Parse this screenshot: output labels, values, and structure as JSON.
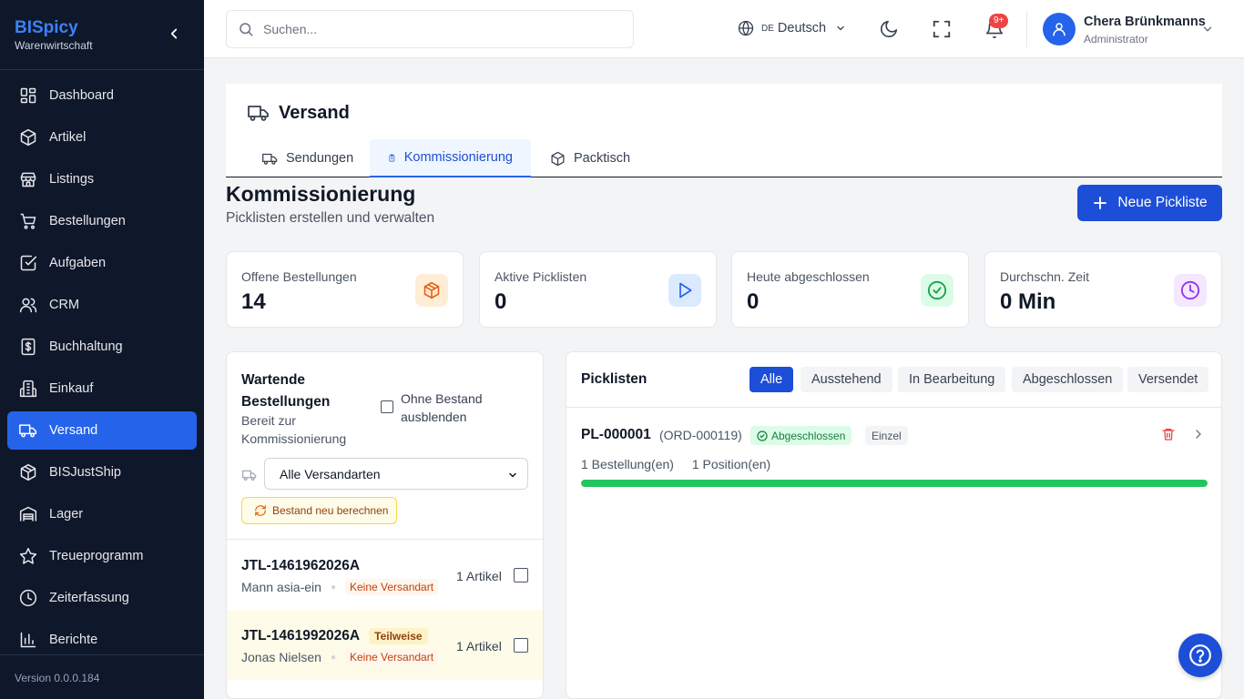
{
  "app": {
    "name": "BISpicy",
    "subtitle": "Warenwirtschaft",
    "version": "Version 0.0.0.184"
  },
  "sidebar": {
    "items": [
      {
        "label": "Dashboard",
        "icon": "dashboard-icon"
      },
      {
        "label": "Artikel",
        "icon": "box-icon"
      },
      {
        "label": "Listings",
        "icon": "store-icon"
      },
      {
        "label": "Bestellungen",
        "icon": "cart-icon"
      },
      {
        "label": "Aufgaben",
        "icon": "checkbox-icon"
      },
      {
        "label": "CRM",
        "icon": "users-icon"
      },
      {
        "label": "Buchhaltung",
        "icon": "dollar-icon"
      },
      {
        "label": "Einkauf",
        "icon": "building-icon"
      },
      {
        "label": "Versand",
        "icon": "truck-icon",
        "active": true
      },
      {
        "label": "BISJustShip",
        "icon": "package-icon"
      },
      {
        "label": "Lager",
        "icon": "warehouse-icon"
      },
      {
        "label": "Treueprogramm",
        "icon": "star-icon"
      },
      {
        "label": "Zeiterfassung",
        "icon": "clock-icon"
      },
      {
        "label": "Berichte",
        "icon": "chart-icon"
      }
    ]
  },
  "header": {
    "search_placeholder": "Suchen...",
    "language_code": "DE",
    "language_label": "Deutsch",
    "notification_count": "9+",
    "user_name": "Chera Brünkmanns",
    "user_role": "Administrator"
  },
  "page": {
    "title": "Versand",
    "tabs": [
      {
        "label": "Sendungen"
      },
      {
        "label": "Kommissionierung",
        "active": true
      },
      {
        "label": "Packtisch"
      }
    ],
    "section_title": "Kommissionierung",
    "section_subtitle": "Picklisten erstellen und verwalten",
    "new_picklist_label": "Neue Pickliste"
  },
  "stats": [
    {
      "label": "Offene Bestellungen",
      "value": "14",
      "icon": "box-icon",
      "color": "#ea580c",
      "bg": "#ffedd5"
    },
    {
      "label": "Aktive Picklisten",
      "value": "0",
      "icon": "play-icon",
      "color": "#2563eb",
      "bg": "#dbeafe"
    },
    {
      "label": "Heute abgeschlossen",
      "value": "0",
      "icon": "check-circle-icon",
      "color": "#16a34a",
      "bg": "#dcfce7"
    },
    {
      "label": "Durchschn. Zeit",
      "value": "0 Min",
      "icon": "clock-icon",
      "color": "#9333ea",
      "bg": "#f3e8ff"
    }
  ],
  "waiting": {
    "title": "Wartende Bestellungen",
    "subtitle": "Bereit zur Kommissionierung",
    "hide_no_stock_label": "Ohne Bestand ausblenden",
    "shipping_select_value": "Alle Versandarten",
    "recalc_label": "Bestand neu berechnen",
    "orders": [
      {
        "id": "JTL-1461962026A",
        "customer": "Mann asia-ein",
        "shipping": "Keine Versandart",
        "count": "1 Artikel",
        "partial": false
      },
      {
        "id": "JTL-1461992026A",
        "customer": "Jonas Nielsen",
        "shipping": "Keine Versandart",
        "count": "1 Artikel",
        "partial": true,
        "partial_label": "Teilweise"
      }
    ]
  },
  "picklists": {
    "title": "Picklisten",
    "filters": [
      {
        "label": "Alle",
        "active": true
      },
      {
        "label": "Ausstehend"
      },
      {
        "label": "In Bearbeitung"
      },
      {
        "label": "Abgeschlossen"
      },
      {
        "label": "Versendet"
      }
    ],
    "items": [
      {
        "id": "PL-000001",
        "order_ref": "(ORD-000119)",
        "status": "Abgeschlossen",
        "type": "Einzel",
        "orders": "1 Bestellung(en)",
        "positions": "1 Position(en)",
        "progress": 1.0
      }
    ]
  },
  "colors": {
    "sidebar_bg": "#0f172a",
    "brand": "#3b82f6",
    "primary": "#1d4ed8",
    "active_nav": "#2563eb",
    "success": "#22c55e"
  }
}
